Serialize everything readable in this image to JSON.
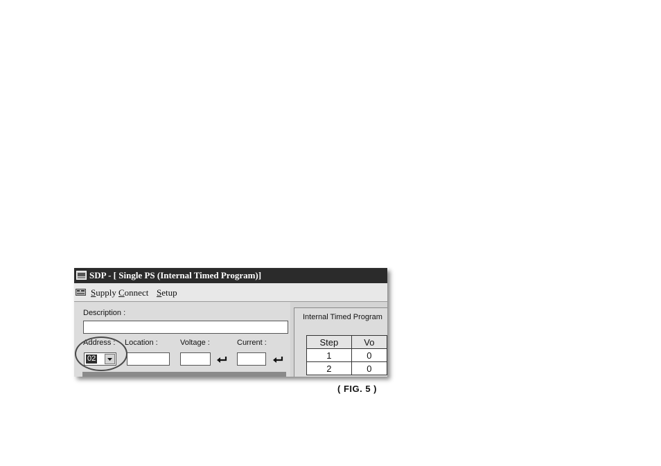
{
  "window": {
    "title": "SDP - [ Single PS (Internal Timed Program)]",
    "icon": "monitor-app-icon"
  },
  "menu": {
    "items": [
      "Supply",
      "Connect",
      "Setup"
    ]
  },
  "form": {
    "description_label": "Description :",
    "description_value": "",
    "address_label": "Address :",
    "address_value": "02",
    "location_label": "Location :",
    "location_value": "",
    "voltage_label": "Voltage :",
    "voltage_value": "",
    "current_label": "Current :",
    "current_value": ""
  },
  "program": {
    "group_label": "Internal Timed Program",
    "columns": [
      "Step",
      "Vo"
    ],
    "rows": [
      [
        "1",
        "0"
      ],
      [
        "2",
        "0"
      ]
    ]
  },
  "caption": "( FIG. 5 )",
  "colors": {
    "titlebar": "#2b2b2b",
    "annotation_circle": "#4a4a4a"
  }
}
